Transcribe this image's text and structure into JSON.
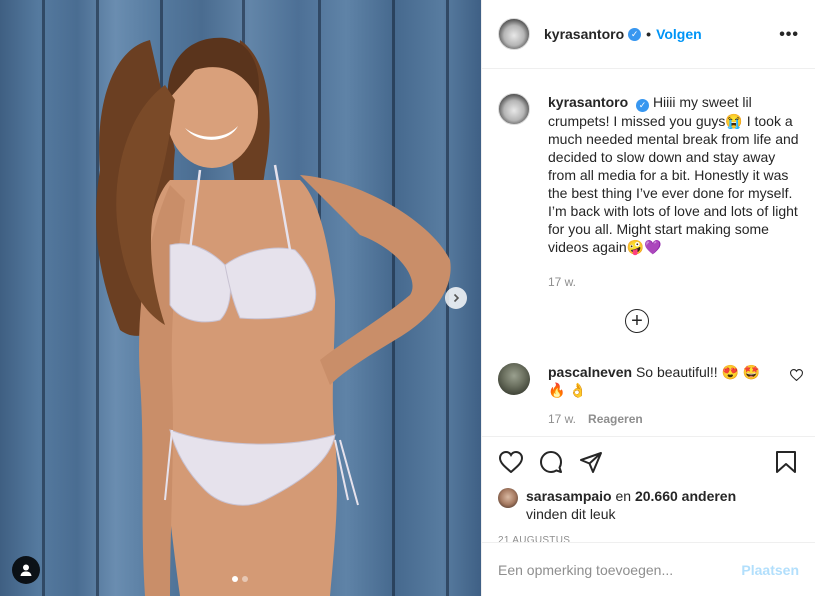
{
  "header": {
    "username": "kyrasantoro",
    "separator": "•",
    "follow_label": "Volgen",
    "more_label": "•••"
  },
  "photo": {
    "carousel_count": 2,
    "carousel_active_index": 0
  },
  "caption": {
    "username": "kyrasantoro",
    "text": "Hiiii my sweet lil crumpets! I missed you guys😭 I took a much needed mental break from life and decided to slow down and stay away from all media for a bit. Honestly it was the best thing I’ve ever done for myself. I’m back with lots of love and lots of light for you all. Might start making some videos again🤪💜",
    "time": "17 w."
  },
  "load_more_label": "+",
  "comments": [
    {
      "username": "pascalneven",
      "text": "So beautiful!! 😍 🤩 🔥 👌",
      "time": "17 w.",
      "reply_label": "Reageren"
    }
  ],
  "likes": {
    "username": "sarasampaio",
    "text_middle": "en",
    "count_text": "20.660 anderen",
    "suffix": "vinden dit leuk"
  },
  "date": "21 AUGUSTUS",
  "add_comment": {
    "placeholder": "Een opmerking toevoegen...",
    "post_label": "Plaatsen"
  },
  "icons": {
    "verified": "verified-badge-icon",
    "more": "more-options-icon",
    "next": "chevron-right-icon",
    "tag": "user-tag-icon",
    "load_more": "plus-circle-icon",
    "like": "heart-icon",
    "comment": "comment-bubble-icon",
    "share": "paper-plane-icon",
    "save": "bookmark-icon"
  },
  "colors": {
    "link_blue": "#0095f6",
    "verified_blue": "#3897f0",
    "muted_gray": "#8e8e8e",
    "post_disabled": "#b2dffc"
  }
}
